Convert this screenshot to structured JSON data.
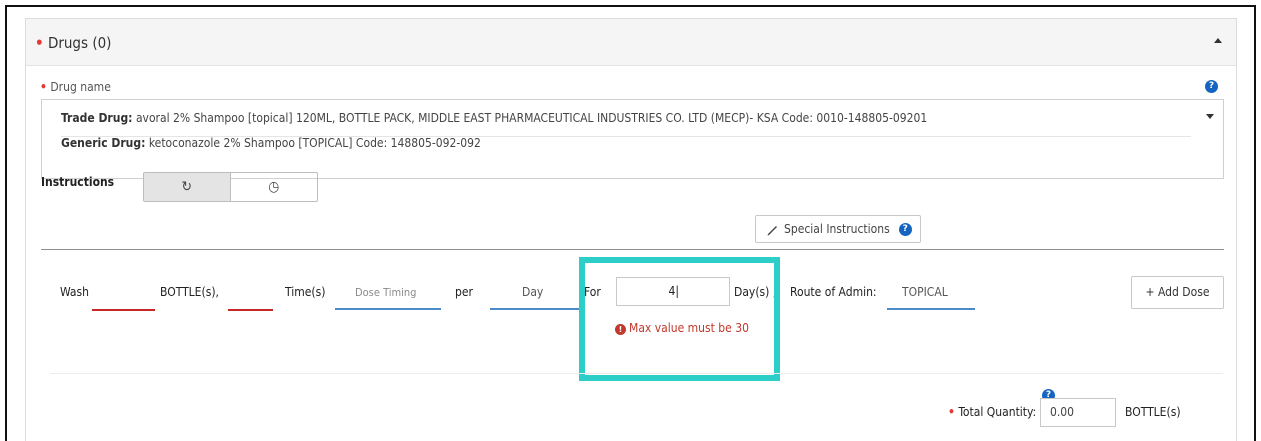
{
  "panel": {
    "title": "Drugs (0)",
    "required_mark": "•"
  },
  "drug_field": {
    "label": "Drug name",
    "required_mark": "•",
    "trade_label": "Trade Drug:",
    "trade_value": "avoral 2% Shampoo [topical] 120ML, BOTTLE PACK, MIDDLE EAST PHARMACEUTICAL INDUSTRIES CO. LTD (MECP)- KSA Code: 0010-148805-09201",
    "generic_label": "Generic Drug:",
    "generic_value": "ketoconazole 2% Shampoo [TOPICAL] Code: 148805-092-092"
  },
  "help_glyph": "?",
  "instructions": {
    "label": "Instructions",
    "toggle_recurring_icon": "↻",
    "toggle_clock_icon": "◷",
    "special_label": "Special Instructions",
    "special_icon": "pencil-icon"
  },
  "dose": {
    "verb": "Wash",
    "unit": "BOTTLE(s),",
    "times": "Time(s)",
    "timing_placeholder": "Dose Timing",
    "per": "per",
    "period": "Day",
    "for": "For",
    "for_value": "4|",
    "days": "Day(s) ,",
    "route_label": "Route of Admin:",
    "route_value": "TOPICAL",
    "add_dose": "+ Add Dose",
    "error_glyph": "!",
    "error": "Max value must be 30"
  },
  "total": {
    "required_mark": "•",
    "label": "Total Quantity:",
    "value": "0.00",
    "unit": "BOTTLE(s)"
  },
  "colors": {
    "error": "#c0392b",
    "highlight": "#2bcfc7",
    "help_blue": "#1565c0",
    "required": "#e53935"
  }
}
